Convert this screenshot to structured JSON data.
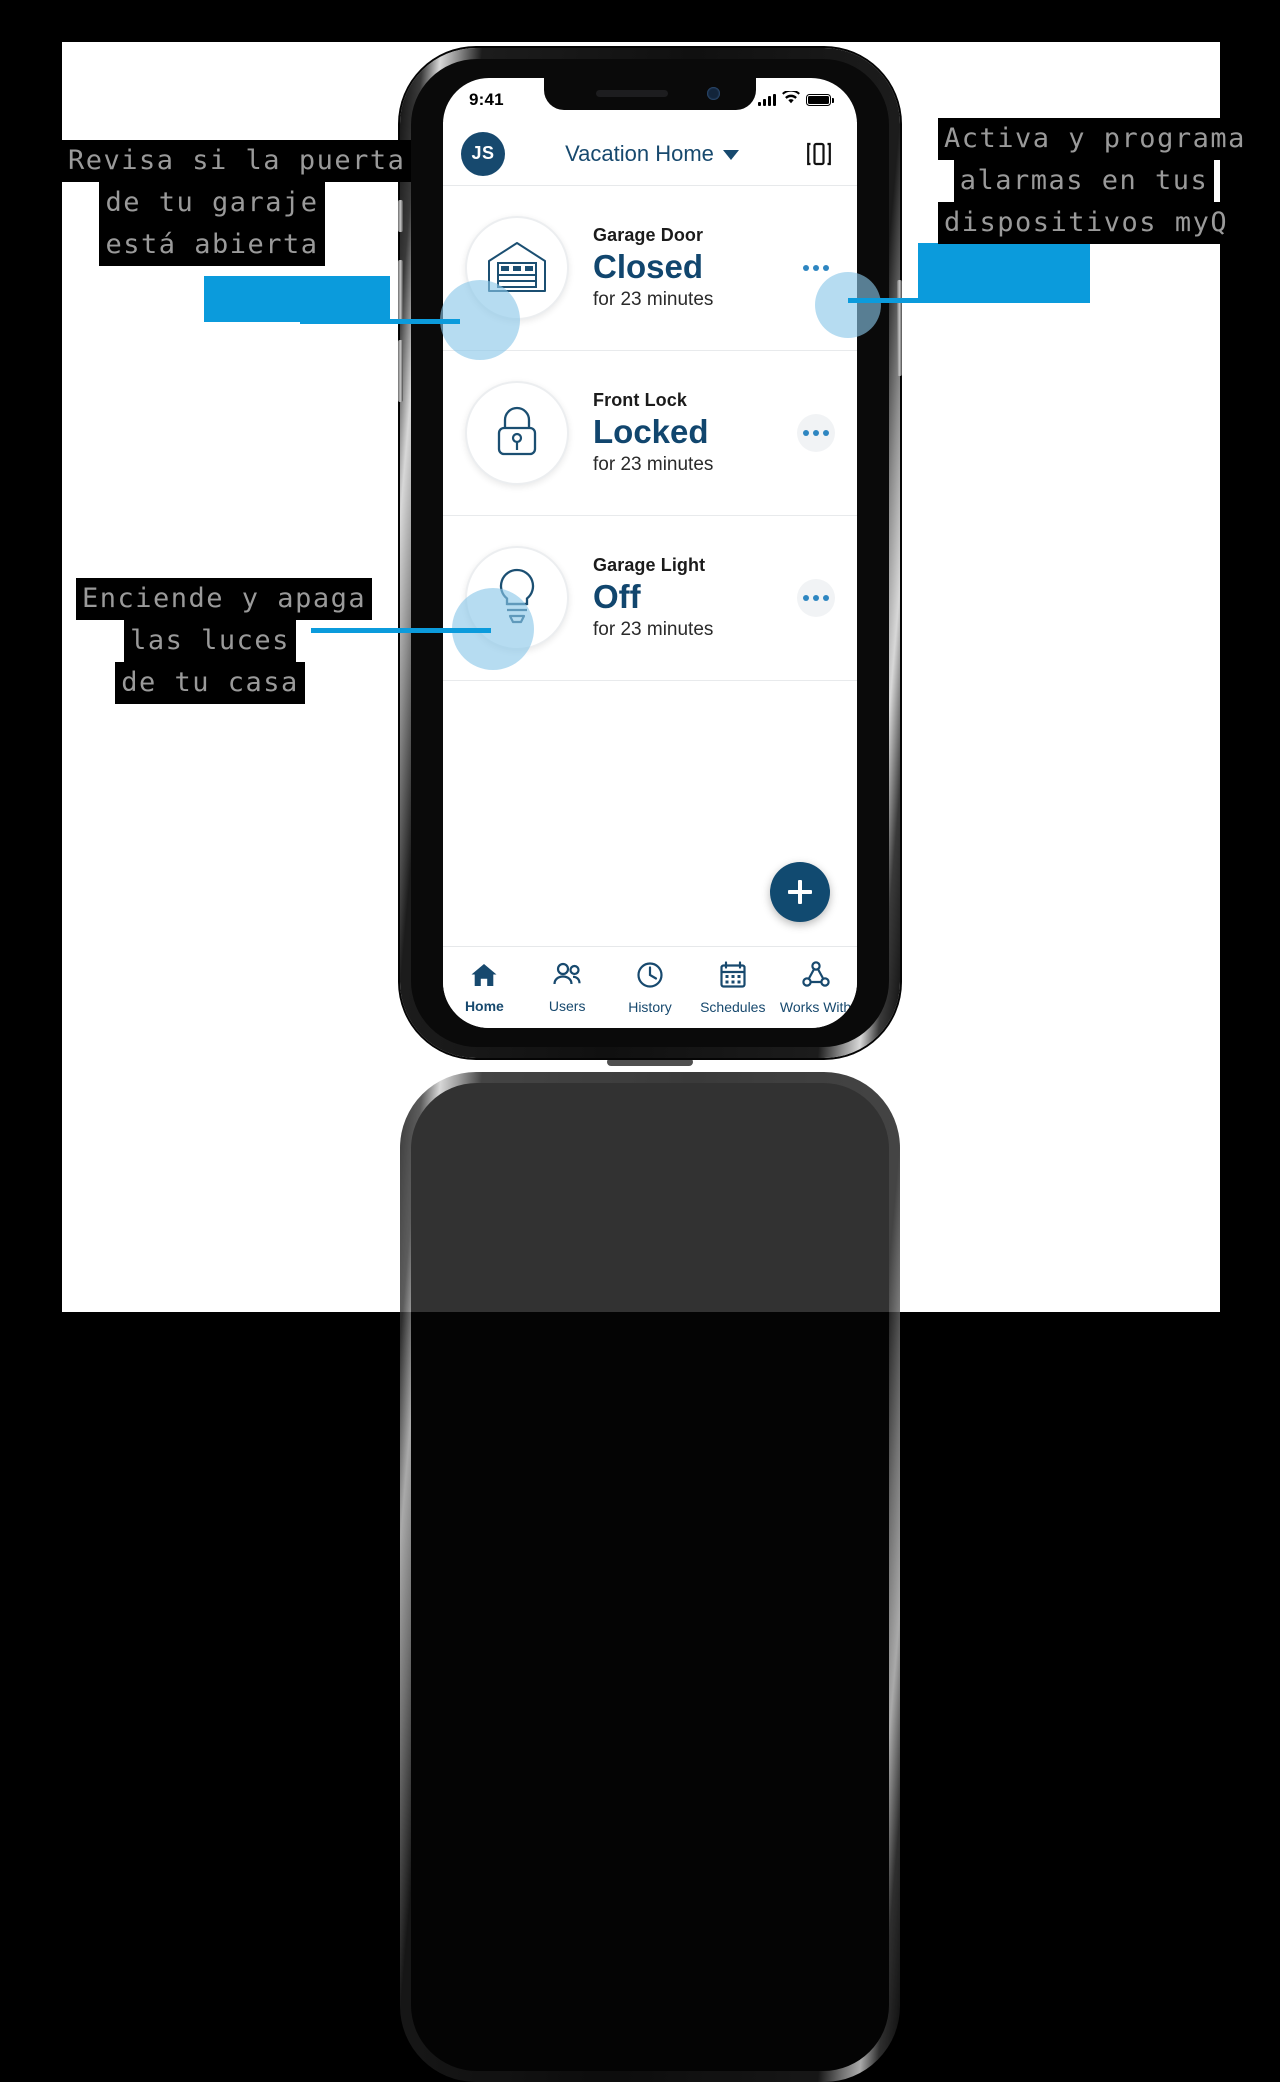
{
  "callouts": [
    {
      "id": "door",
      "lines": [
        "Revisa si la puerta",
        "de tu garaje",
        "está abierta"
      ]
    },
    {
      "id": "light",
      "lines": [
        "Enciende y apaga",
        "las luces",
        "de tu casa"
      ]
    },
    {
      "id": "alarm",
      "lines": [
        "Activa y programa",
        "alarmas en tus",
        "dispositivos myQ"
      ]
    }
  ],
  "status_bar": {
    "time": "9:41",
    "signal_icon": "cellular-bars-icon",
    "wifi_icon": "wifi-icon",
    "battery_icon": "battery-full-icon"
  },
  "header": {
    "avatar_initials": "JS",
    "title": "Vacation Home",
    "caret_icon": "chevron-down-icon",
    "scan_icon": "scan-device-icon"
  },
  "devices": [
    {
      "icon": "garage-door-icon",
      "name": "Garage Door",
      "state": "Closed",
      "sub": "for 23 minutes",
      "menu_icon": "more-horizontal-icon",
      "highlighted": true
    },
    {
      "icon": "lock-icon",
      "name": "Front Lock",
      "state": "Locked",
      "sub": "for 23 minutes",
      "menu_icon": "more-horizontal-icon",
      "highlighted": false
    },
    {
      "icon": "light-bulb-icon",
      "name": "Garage Light",
      "state": "Off",
      "sub": "for 23 minutes",
      "menu_icon": "more-horizontal-icon",
      "highlighted": false
    }
  ],
  "fab": {
    "icon": "plus-icon",
    "label": "+"
  },
  "tabs": [
    {
      "icon": "home-icon",
      "label": "Home",
      "active": true
    },
    {
      "icon": "users-icon",
      "label": "Users",
      "active": false
    },
    {
      "icon": "clock-icon",
      "label": "History",
      "active": false
    },
    {
      "icon": "calendar-icon",
      "label": "Schedules",
      "active": false
    },
    {
      "icon": "works-with-icon",
      "label": "Works With",
      "active": false
    }
  ],
  "colors": {
    "accent_blue": "#0b9bdc",
    "brand_navy": "#17496e",
    "state_navy": "#11466e",
    "highlight_blue": "#89c6e8",
    "callout_text": "#9a9a9a",
    "callout_bg": "#000000"
  }
}
